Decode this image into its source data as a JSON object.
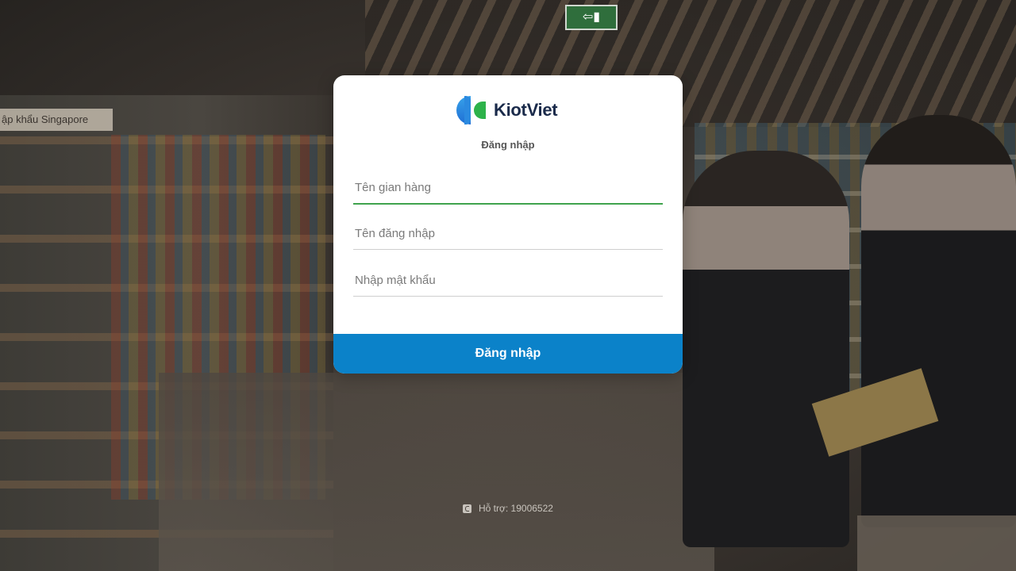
{
  "background": {
    "sign_text": "ập khẩu Singapore"
  },
  "login": {
    "title": "Đăng nhập",
    "store_placeholder": "Tên gian hàng",
    "username_placeholder": "Tên đăng nhập",
    "password_placeholder": "Nhập mật khẩu",
    "submit_label": "Đăng nhập"
  },
  "brand": {
    "name": "KiotViet",
    "accent": "#0b82c9",
    "active_field_color": "#3fa34d"
  },
  "footer": {
    "support_text": "Hỗ trợ: 19006522",
    "icon": "phone-icon"
  }
}
